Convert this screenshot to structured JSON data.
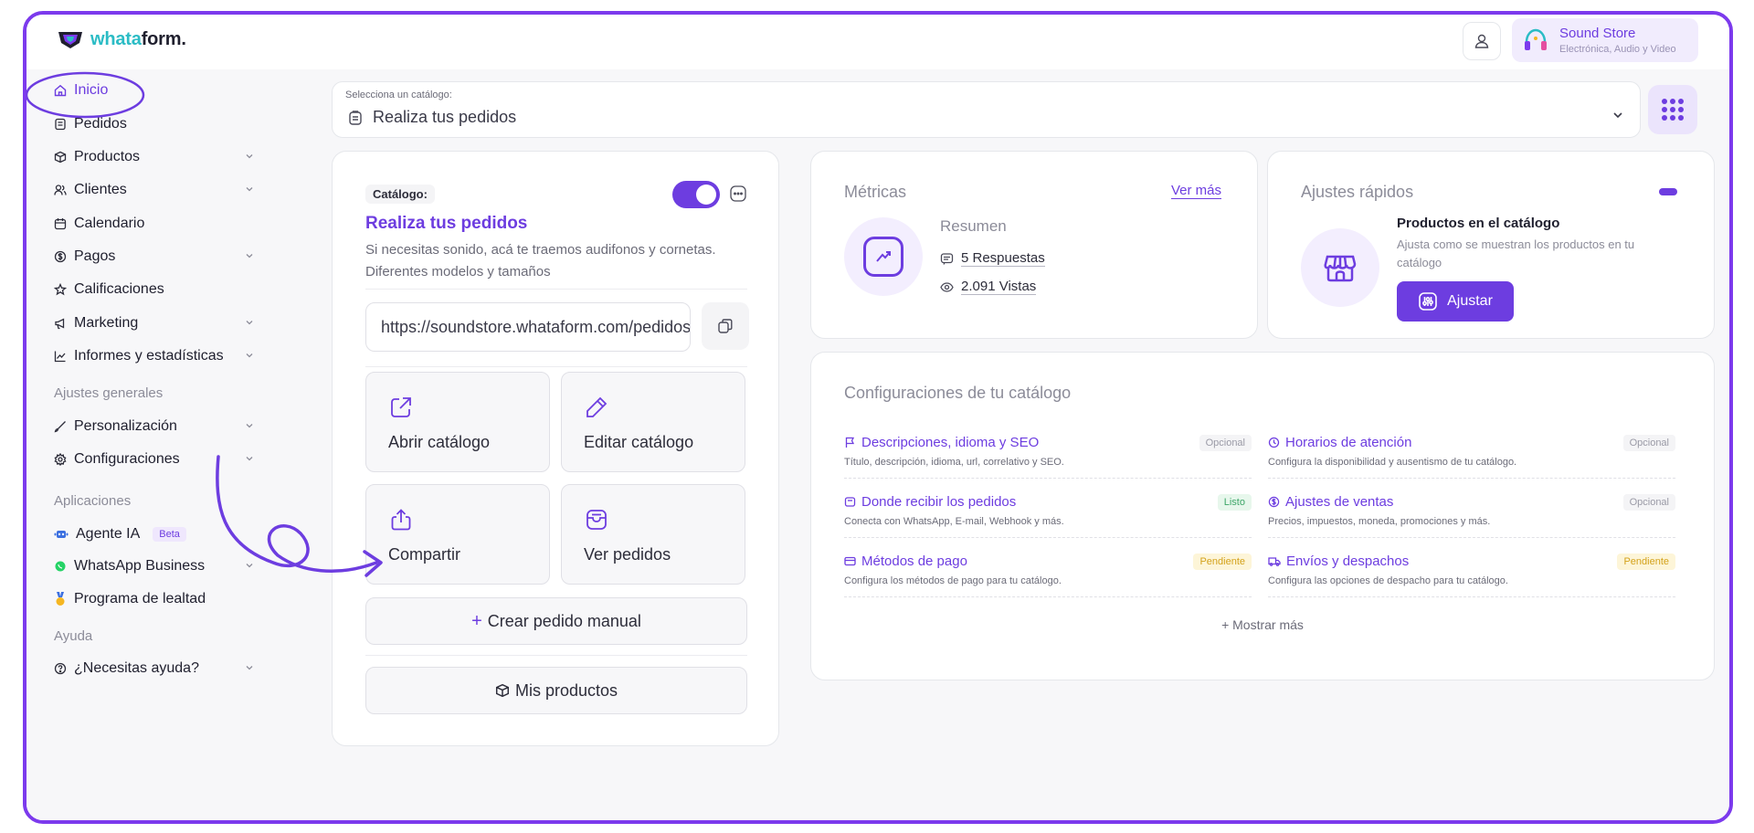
{
  "brand": {
    "name_part1": "whata",
    "name_part2": "form.",
    "accent": "#6d3de0",
    "teal": "#2bbcc5"
  },
  "header": {
    "store_name": "Sound Store",
    "store_desc": "Electrónica, Audio y Video",
    "user_icon": "user-icon"
  },
  "sidebar": {
    "items": [
      {
        "label": "Inicio",
        "icon": "home-icon",
        "active": true,
        "chevron": false
      },
      {
        "label": "Pedidos",
        "icon": "orders-icon",
        "chevron": false
      },
      {
        "label": "Productos",
        "icon": "box-icon",
        "chevron": true
      },
      {
        "label": "Clientes",
        "icon": "users-icon",
        "chevron": true
      },
      {
        "label": "Calendario",
        "icon": "calendar-icon",
        "chevron": false
      },
      {
        "label": "Pagos",
        "icon": "coin-icon",
        "chevron": true
      },
      {
        "label": "Calificaciones",
        "icon": "star-icon",
        "chevron": false
      },
      {
        "label": "Marketing",
        "icon": "megaphone-icon",
        "chevron": true
      },
      {
        "label": "Informes y estadísticas",
        "icon": "chart-icon",
        "chevron": true
      }
    ],
    "section_general": "Ajustes generales",
    "general_items": [
      {
        "label": "Personalización",
        "icon": "brush-icon",
        "chevron": true
      },
      {
        "label": "Configuraciones",
        "icon": "gear-icon",
        "chevron": true
      }
    ],
    "section_apps": "Aplicaciones",
    "app_items": [
      {
        "label": "Agente IA",
        "icon": "robot-icon",
        "badge": "Beta"
      },
      {
        "label": "WhatsApp Business",
        "icon": "whatsapp-icon",
        "chevron": true
      },
      {
        "label": "Programa de lealtad",
        "icon": "medal-icon"
      }
    ],
    "section_help": "Ayuda",
    "help_items": [
      {
        "label": "¿Necesitas ayuda?",
        "icon": "help-icon",
        "chevron": true
      }
    ]
  },
  "catalog_select": {
    "label": "Selecciona un catálogo:",
    "value": "Realiza tus pedidos"
  },
  "catalog_card": {
    "tag": "Catálogo:",
    "title": "Realiza tus pedidos",
    "description": "Si necesitas sonido, acá te traemos audifonos y cornetas. Diferentes modelos y tamaños",
    "url": "https://soundstore.whataform.com/pedidos",
    "enabled": true,
    "tiles": [
      {
        "label": "Abrir catálogo",
        "icon": "external-link-icon"
      },
      {
        "label": "Editar catálogo",
        "icon": "pencil-icon"
      },
      {
        "label": "Compartir",
        "icon": "share-icon"
      },
      {
        "label": "Ver pedidos",
        "icon": "orders-icon"
      }
    ],
    "manual_order": "Crear pedido manual",
    "manual_order_prefix": "+",
    "my_products": "Mis productos"
  },
  "metrics": {
    "title": "Métricas",
    "see_more": "Ver más",
    "summary": "Resumen",
    "responses": "5 Respuestas",
    "views": "2.091 Vistas"
  },
  "quick": {
    "title": "Ajustes rápidos",
    "item_title": "Productos en el catálogo",
    "item_desc": "Ajusta como se muestran los productos en tu catálogo",
    "button": "Ajustar"
  },
  "config": {
    "title": "Configuraciones de tu catálogo",
    "items": [
      {
        "title": "Descripciones, idioma y SEO",
        "desc": "Título, descripción, idioma, url, correlativo y SEO.",
        "badge": "Opcional",
        "status": "op",
        "icon": "flag-icon"
      },
      {
        "title": "Horarios de atención",
        "desc": "Configura la disponibilidad y ausentismo de tu catálogo.",
        "badge": "Opcional",
        "status": "op",
        "icon": "clock-icon"
      },
      {
        "title": "Donde recibir los pedidos",
        "desc": "Conecta con WhatsApp, E-mail, Webhook y más.",
        "badge": "Listo",
        "status": "ok",
        "icon": "inbox-icon"
      },
      {
        "title": "Ajustes de ventas",
        "desc": "Precios, impuestos, moneda, promociones y más.",
        "badge": "Opcional",
        "status": "op",
        "icon": "coin-icon"
      },
      {
        "title": "Métodos de pago",
        "desc": "Configura los métodos de pago para tu catálogo.",
        "badge": "Pendiente",
        "status": "pe",
        "icon": "card-icon"
      },
      {
        "title": "Envíos y despachos",
        "desc": "Configura las opciones de despacho para tu catálogo.",
        "badge": "Pendiente",
        "status": "pe",
        "icon": "truck-icon"
      }
    ],
    "show_more": "Mostrar más",
    "show_more_prefix": "+"
  }
}
